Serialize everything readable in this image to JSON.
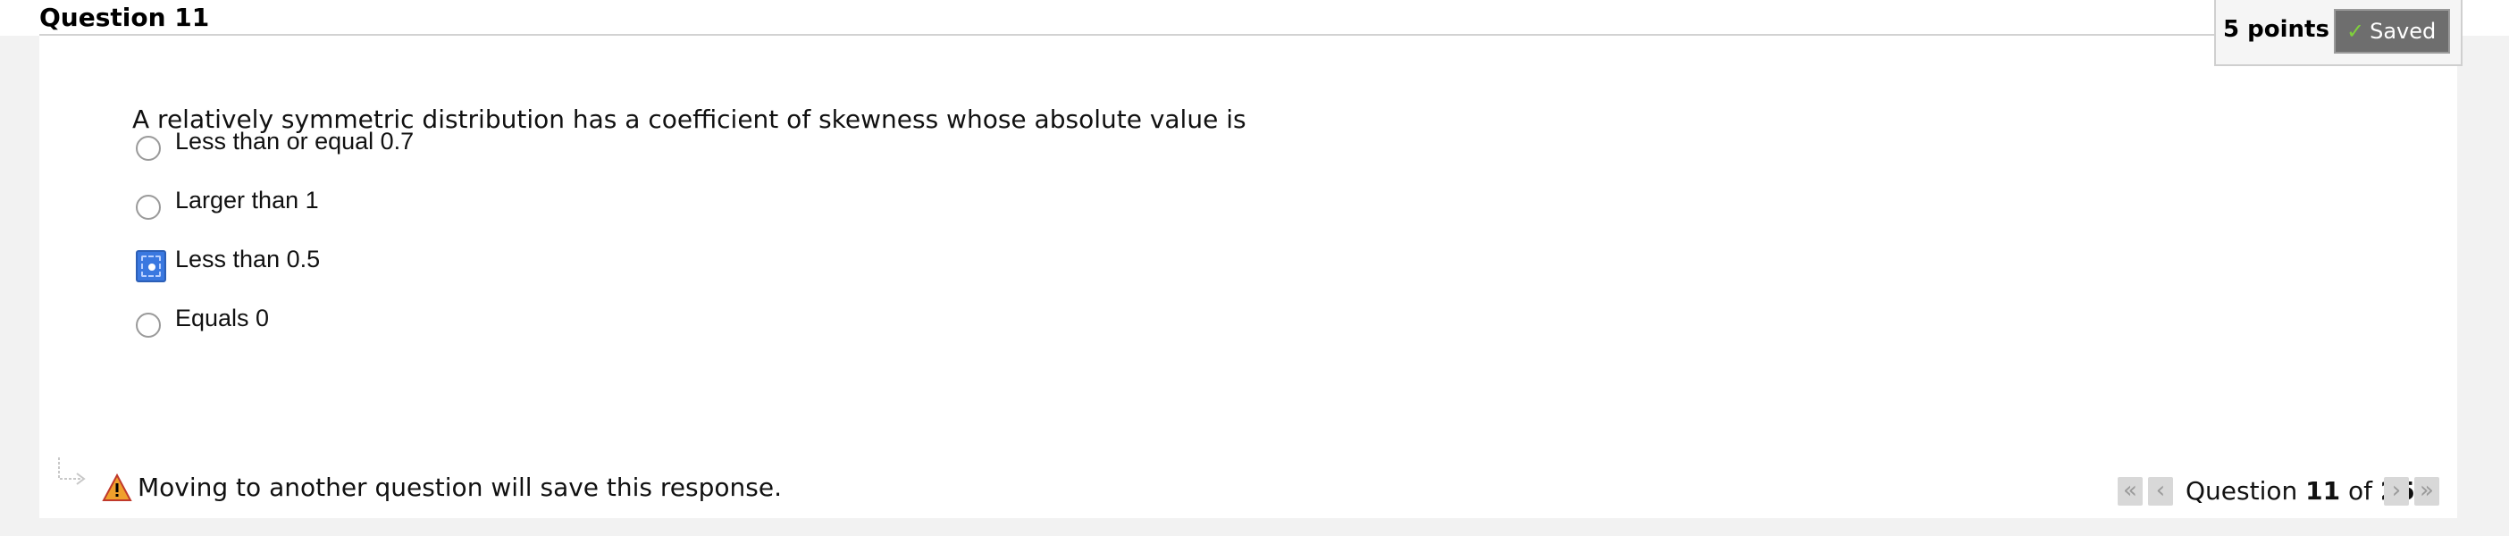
{
  "question": {
    "title": "Question 11",
    "points": "5 points",
    "saved_label": "Saved",
    "text": "A relatively symmetric distribution has a coefficient of skewness whose absolute value is",
    "options": [
      {
        "label": "Less than or equal 0.7",
        "selected": false
      },
      {
        "label": "Larger than 1",
        "selected": false
      },
      {
        "label": "Less than 0.5",
        "selected": true
      },
      {
        "label": "Equals 0",
        "selected": false
      }
    ]
  },
  "footer": {
    "warning_text": "Moving to another question will save this response.",
    "nav_prefix": "Question",
    "current": "11",
    "of_label": "of",
    "total": "25",
    "icons": [
      "first-page-icon",
      "previous-icon",
      "next-icon",
      "last-page-icon"
    ]
  },
  "colors": {
    "selected_radio": "#3a78e0",
    "saved_button": "#6e6e6e",
    "check": "#7fd13b",
    "warning": "#f0a02c"
  }
}
